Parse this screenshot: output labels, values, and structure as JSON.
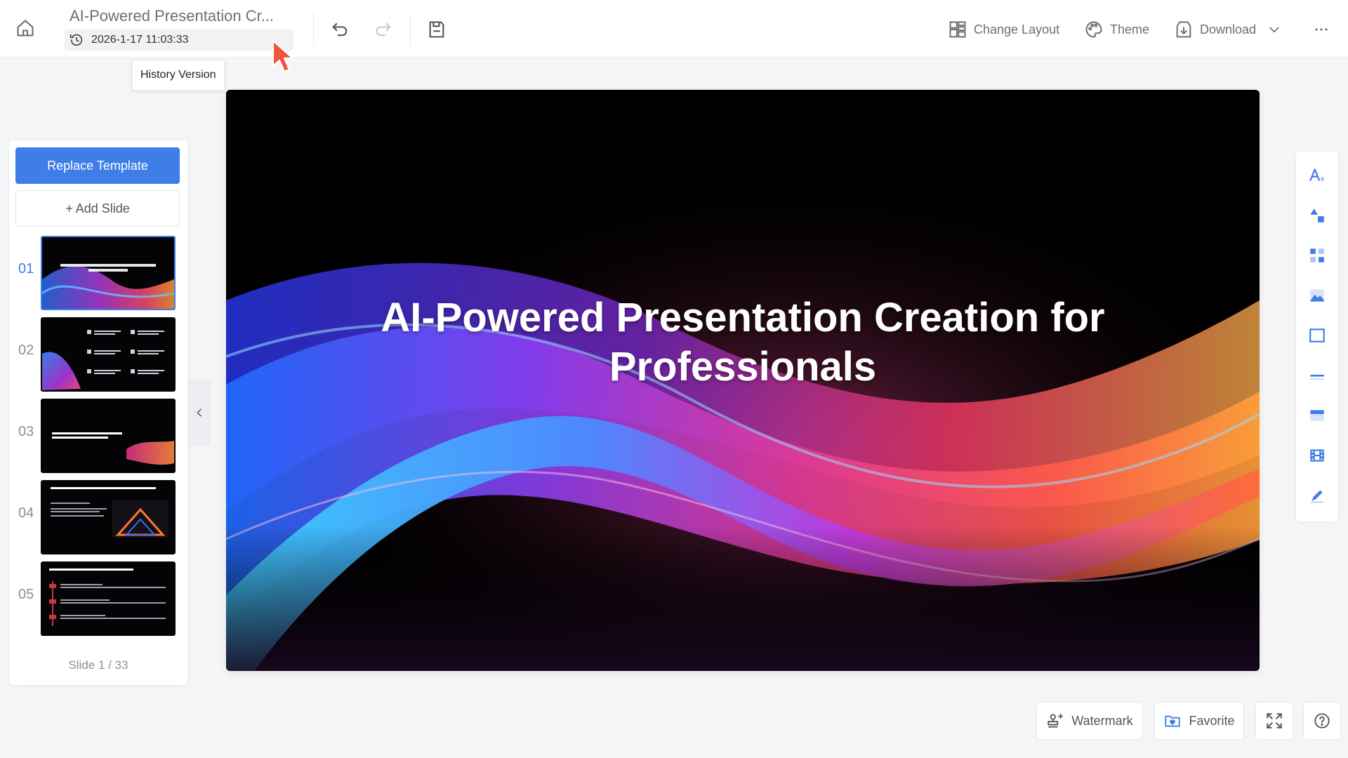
{
  "header": {
    "doc_title": "AI-Powered Presentation Cr...",
    "version_time": "2026-1-17 11:03:33",
    "tooltip": "History Version",
    "change_layout_label": "Change Layout",
    "theme_label": "Theme",
    "download_label": "Download"
  },
  "sidebar": {
    "replace_template_label": "Replace Template",
    "add_slide_label": "+ Add Slide",
    "slides": [
      {
        "num": "01"
      },
      {
        "num": "02"
      },
      {
        "num": "03"
      },
      {
        "num": "04"
      },
      {
        "num": "05"
      }
    ],
    "counter": "Slide 1 / 33"
  },
  "canvas": {
    "title": "AI-Powered Presentation Creation for Professionals"
  },
  "right_toolbar": {
    "icons": [
      "text-icon",
      "shapes-icon",
      "elements-icon",
      "image-icon",
      "frame-icon",
      "line-icon",
      "table-icon",
      "video-icon",
      "draw-icon"
    ]
  },
  "footer": {
    "watermark_label": "Watermark",
    "favorite_label": "Favorite"
  },
  "colors": {
    "accent": "#3f7ee8",
    "toolbar_icon": "#3f7ee8",
    "cursor": "#f0553a"
  }
}
